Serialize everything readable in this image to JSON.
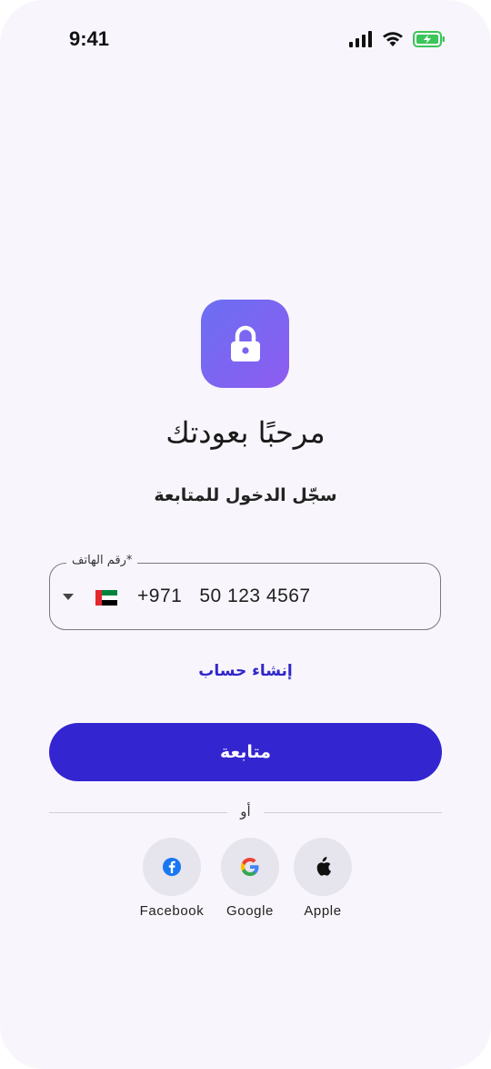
{
  "status_bar": {
    "time": "9:41",
    "battery_color": "#3cc55a"
  },
  "header": {
    "icon": "lock-icon",
    "title": "مرحبًا بعودتك",
    "subtitle": "سجّل الدخول للمتابعة"
  },
  "phone_field": {
    "label": "*رقم الهاتف",
    "country_flag": "ae-flag-icon",
    "country_code": "+971",
    "number": "50 123 4567"
  },
  "create_account_link": "إنشاء حساب",
  "continue_button": "متابعة",
  "divider_text": "أو",
  "social_logins": [
    {
      "label": "Facebook",
      "icon": "facebook-icon"
    },
    {
      "label": "Google",
      "icon": "google-icon"
    },
    {
      "label": "Apple",
      "icon": "apple-icon"
    }
  ],
  "colors": {
    "primary": "#3325d0",
    "link": "#3027c9",
    "background": "#f8f6fc"
  }
}
